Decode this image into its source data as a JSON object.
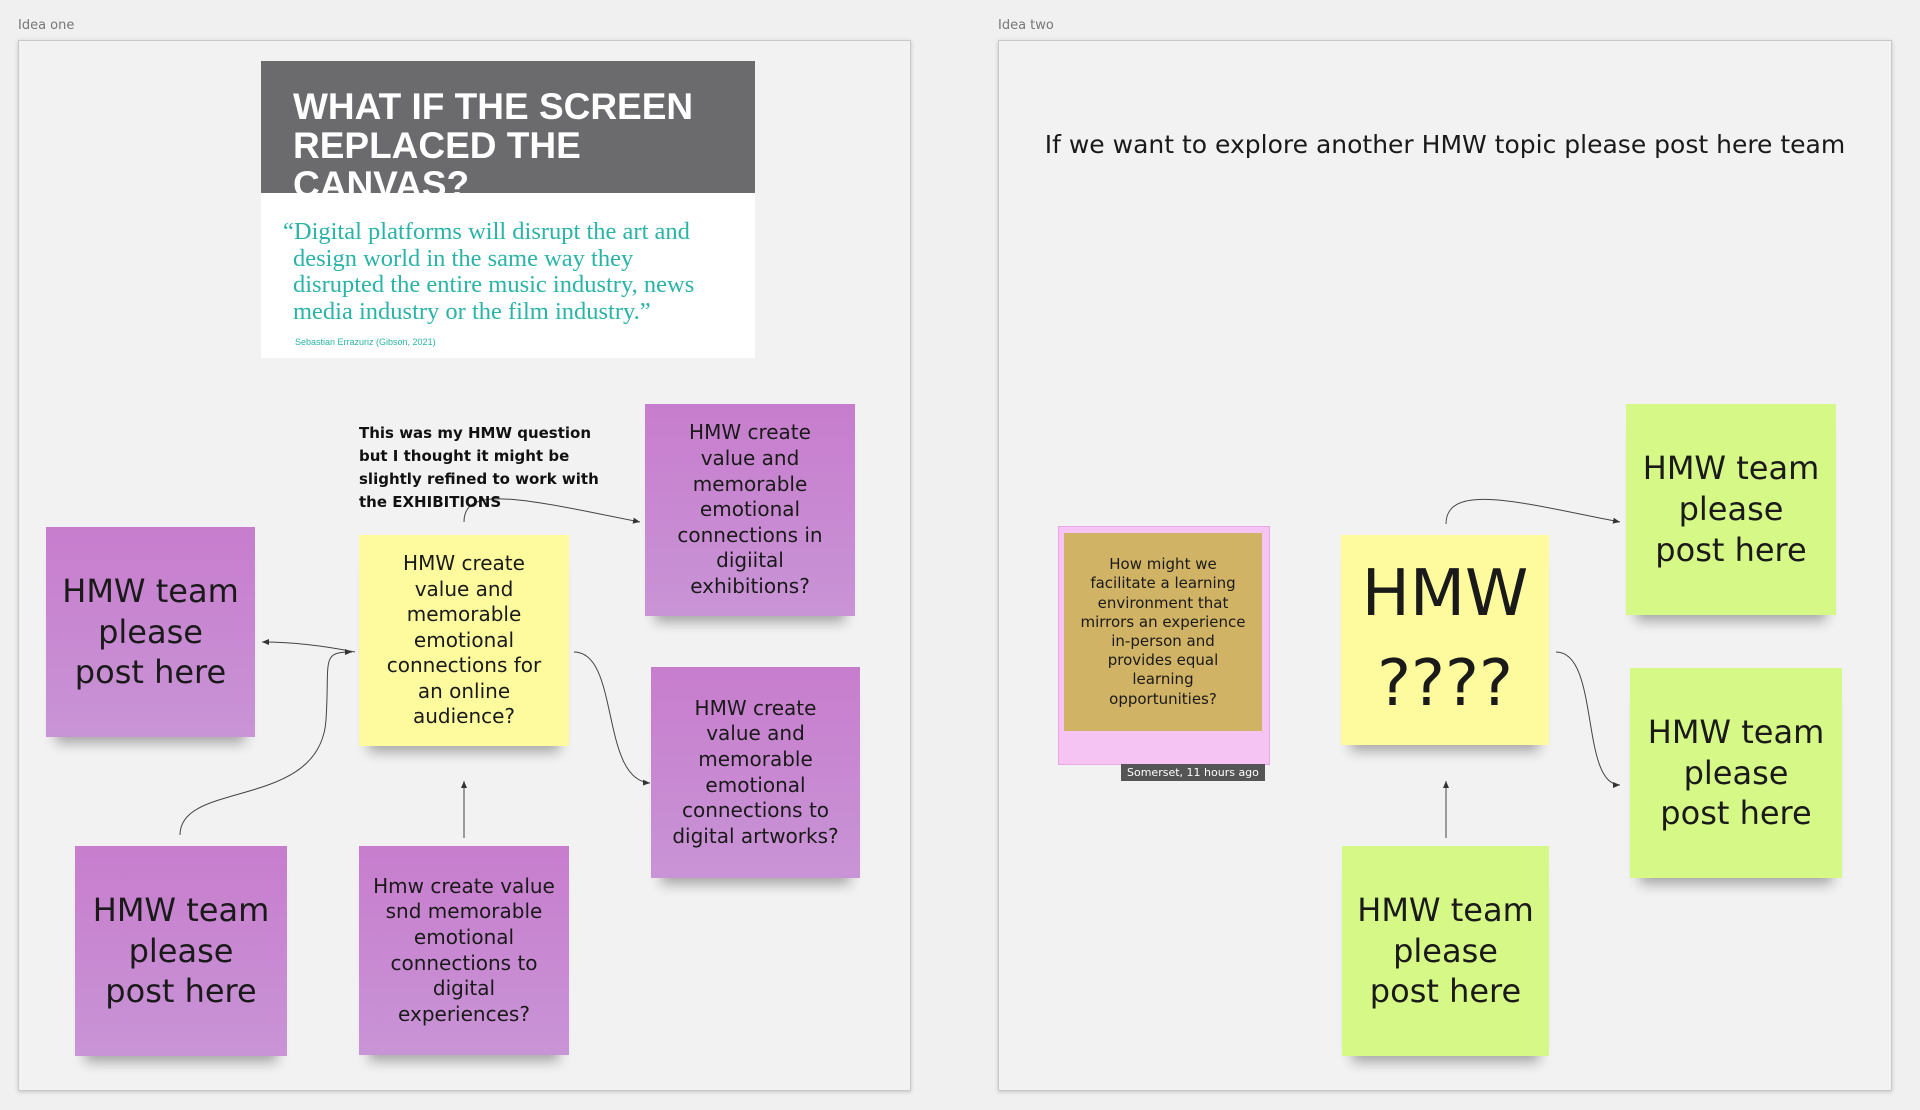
{
  "frames": {
    "idea_one_label": "Idea one",
    "idea_two_label": "Idea two"
  },
  "idea_one": {
    "hero_title_line1": "WHAT IF THE SCREEN",
    "hero_title_line2": "REPLACED THE CANVAS?",
    "hero_quote": "“Digital platforms will disrupt the art and design world in the same way they disrupted the entire music industry, news media industry or the film industry.”",
    "hero_citation": "Sebastian Errazuriz (Gibson, 2021)",
    "annotation": "This was my HMW question but I thought it might be slightly refined to work with the EXHIBITIONS",
    "center_note": "HMW create value and memorable emotional connections for an online audience?",
    "note_exhibitions": "HMW create value and memorable emotional connections in digiital exhibitions?",
    "note_artworks": "HMW create value and memorable emotional connections to digital artworks?",
    "note_experiences": "Hmw create value snd memorable emotional connections to digital experiences?",
    "note_team_left": "HMW team please post here",
    "note_team_bottom_left": "HMW team please post here"
  },
  "idea_two": {
    "heading": "If we want to explore another HMW topic please post here team",
    "olive_note": "How might we facilitate a learning environment that mirrors an experience in-person and provides equal learning opportunities?",
    "author_tag": "Somerset, 11 hours ago",
    "center_line1": "HMW",
    "center_line2": "????",
    "note_team_top_right": "HMW team please post here",
    "note_team_right": "HMW team please post here",
    "note_team_bottom": "HMW team please post here"
  },
  "colors": {
    "purple": "#c77dcd",
    "yellow": "#fdfb9e",
    "green": "#d6f886",
    "olive": "#d0b364",
    "hero_header": "#6b6a6c",
    "quote_teal": "#2ab3a6"
  }
}
